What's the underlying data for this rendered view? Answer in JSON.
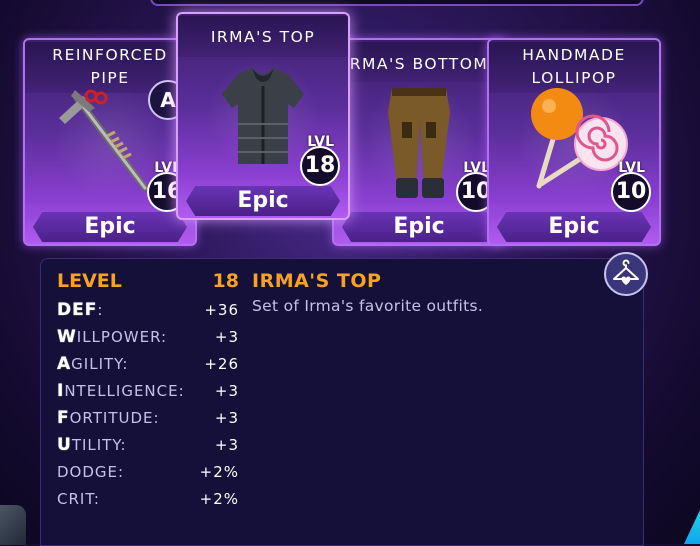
{
  "items": [
    {
      "name": "REINFORCED\nPIPE",
      "rarity": "Epic",
      "lvl_label": "LVL",
      "level": "16",
      "grade": "A",
      "icon": "pipe-weapon-icon"
    },
    {
      "name": "IRMA'S TOP",
      "rarity": "Epic",
      "lvl_label": "LVL",
      "level": "18",
      "icon": "armor-vest-icon"
    },
    {
      "name": "RMA'S BOTTOM",
      "rarity": "Epic",
      "lvl_label": "LVL",
      "level": "10",
      "icon": "pants-icon"
    },
    {
      "name": "HANDMADE\nLOLLIPOP",
      "rarity": "Epic",
      "lvl_label": "LVL",
      "level": "10",
      "icon": "lollipop-icon"
    }
  ],
  "details": {
    "level_label": "LEVEL",
    "level_value": "18",
    "item_name": "IRMA'S TOP",
    "description": "Set of Irma's favorite outfits.",
    "stats": [
      {
        "initial": "DEF",
        "rest": ":",
        "value": "+36"
      },
      {
        "initial": "W",
        "rest": "ILLPOWER:",
        "value": "+3"
      },
      {
        "initial": "A",
        "rest": "GILITY:",
        "value": "+26"
      },
      {
        "initial": "I",
        "rest": "NTELLIGENCE:",
        "value": "+3"
      },
      {
        "initial": "F",
        "rest": "ORTITUDE:",
        "value": "+3"
      },
      {
        "initial": "U",
        "rest": "TILITY:",
        "value": "+3"
      },
      {
        "initial": "",
        "rest": "DODGE:",
        "value": "+2%"
      },
      {
        "initial": "",
        "rest": "CRIT:",
        "value": "+2%"
      }
    ]
  },
  "wardrobe_icon": "hanger-heart-icon",
  "colors": {
    "accent": "#f8a21e",
    "card_border": "#b070f0",
    "panel_bg": "#15103a"
  }
}
